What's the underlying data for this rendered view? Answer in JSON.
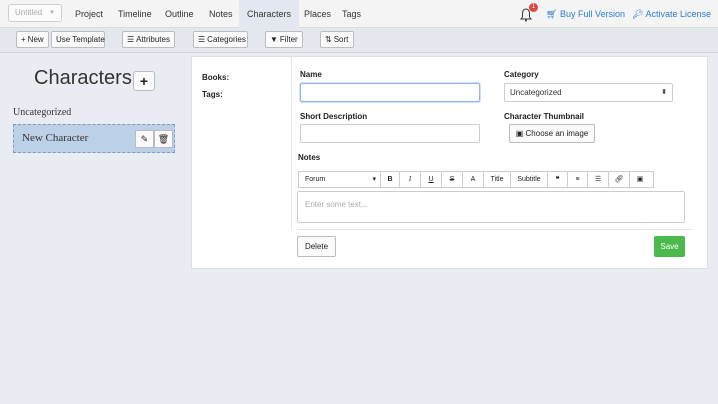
{
  "nav": {
    "project_select": "Untitled",
    "items": [
      "Project",
      "Timeline",
      "Outline",
      "Notes",
      "Characters",
      "Places",
      "Tags"
    ],
    "notification_count": "1",
    "buy": "Buy Full Version",
    "activate": "Activate License"
  },
  "toolbar": {
    "new": "New",
    "use_template": "Use Template",
    "attributes": "Attributes",
    "categories": "Categories",
    "filter": "Filter",
    "sort": "Sort"
  },
  "sidebar": {
    "title": "Characters",
    "add": "+",
    "group": "Uncategorized",
    "character": "New Character"
  },
  "form": {
    "books_label": "Books:",
    "tags_label": "Tags:",
    "name_label": "Name",
    "name_value": "",
    "short_desc_label": "Short Description",
    "short_desc_value": "",
    "category_label": "Category",
    "category_value": "Uncategorized",
    "thumbnail_label": "Character Thumbnail",
    "choose_image": "Choose an image",
    "notes_label": "Notes",
    "font_select": "Forum",
    "title_btn": "Title",
    "subtitle_btn": "Subtitle",
    "notes_placeholder": "Enter some text...",
    "delete": "Delete",
    "save": "Save"
  },
  "colors": {
    "accent": "#2d7ed2",
    "save_green": "#4cb94c",
    "badge_red": "#e04848",
    "selected_item": "#bcd0e8"
  }
}
